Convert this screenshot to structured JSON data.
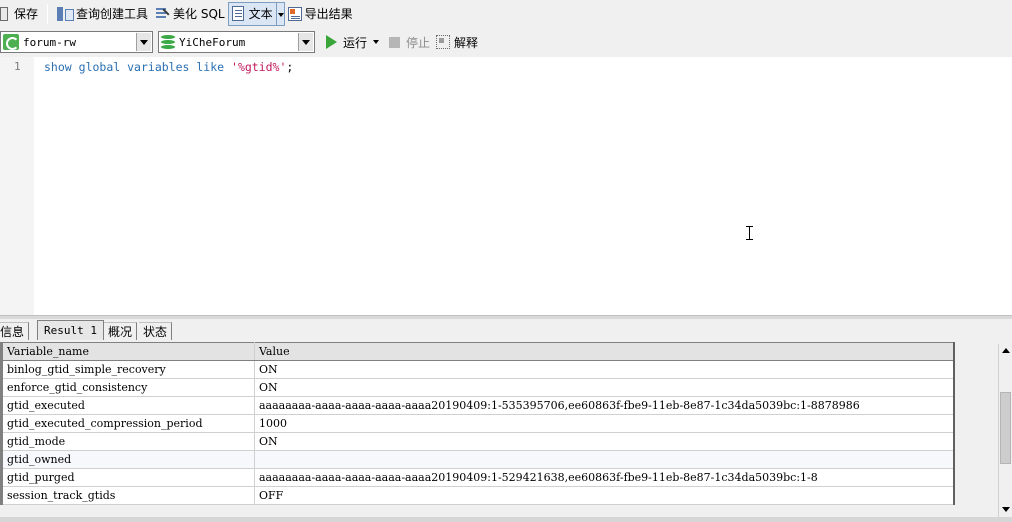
{
  "toolbar": {
    "save": "保存",
    "query_builder": "查询创建工具",
    "beautify": "美化 SQL",
    "text": "文本",
    "export": "导出结果"
  },
  "connection_bar": {
    "connection": "forum-rw",
    "database": "YiCheForum",
    "run": "运行",
    "stop": "停止",
    "explain": "解释"
  },
  "editor": {
    "line_number": "1",
    "tokens": {
      "kw1": "show",
      "kw2": "global",
      "kw3": "variables",
      "kw4": "like",
      "literal": "'%gtid%'",
      "terminator": ";"
    }
  },
  "result_tabs": [
    "信息",
    "Result 1",
    "概况",
    "状态"
  ],
  "result": {
    "columns": [
      "Variable_name",
      "Value"
    ],
    "rows": [
      [
        "binlog_gtid_simple_recovery",
        "ON"
      ],
      [
        "enforce_gtid_consistency",
        "ON"
      ],
      [
        "gtid_executed",
        "aaaaaaaa-aaaa-aaaa-aaaa-aaaa20190409:1-535395706,ee60863f-fbe9-11eb-8e87-1c34da5039bc:1-8878986"
      ],
      [
        "gtid_executed_compression_period",
        "1000"
      ],
      [
        "gtid_mode",
        "ON"
      ],
      [
        "gtid_owned",
        ""
      ],
      [
        "gtid_purged",
        "aaaaaaaa-aaaa-aaaa-aaaa-aaaa20190409:1-529421638,ee60863f-fbe9-11eb-8e87-1c34da5039bc:1-8"
      ],
      [
        "session_track_gtids",
        "OFF"
      ]
    ]
  }
}
